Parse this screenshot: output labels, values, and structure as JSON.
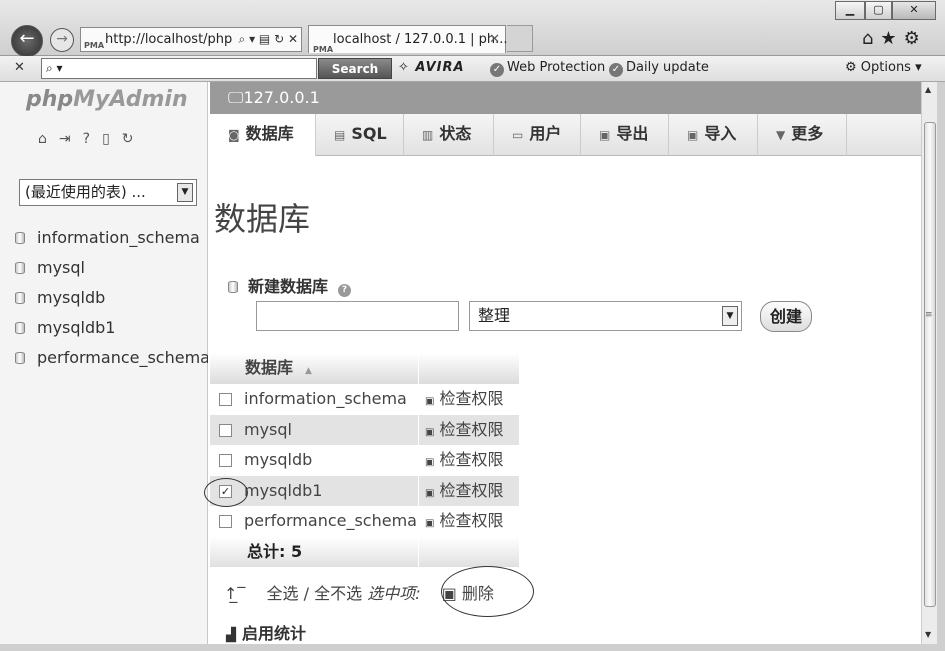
{
  "browser": {
    "address": "http://localhost/php",
    "tab_title": "localhost / 127.0.0.1 | ph...",
    "search_btn": "Search",
    "avira": "AVIRA",
    "web_protection": "Web Protection",
    "daily_update": "Daily update",
    "options": "Options"
  },
  "sidebar": {
    "logo_php": "php",
    "logo_myadmin": "MyAdmin",
    "recent_select": "(最近使用的表) ...",
    "databases": [
      "information_schema",
      "mysql",
      "mysqldb",
      "mysqldb1",
      "performance_schema"
    ]
  },
  "server": "127.0.0.1",
  "tabs": [
    "数据库",
    "SQL",
    "状态",
    "用户",
    "导出",
    "导入",
    "更多"
  ],
  "page_title": "数据库",
  "create": {
    "label": "新建数据库",
    "collation": "整理",
    "button": "创建"
  },
  "table": {
    "header": "数据库",
    "rows": [
      {
        "name": "information_schema",
        "privileges": "检查权限",
        "checked": false
      },
      {
        "name": "mysql",
        "privileges": "检查权限",
        "checked": false
      },
      {
        "name": "mysqldb",
        "privileges": "检查权限",
        "checked": false
      },
      {
        "name": "mysqldb1",
        "privileges": "检查权限",
        "checked": true
      },
      {
        "name": "performance_schema",
        "privileges": "检查权限",
        "checked": false
      }
    ],
    "total": "总计: 5"
  },
  "bulk": {
    "select_all": "全选",
    "divider": "/",
    "select_none": "全不选",
    "with_selected": "选中项:",
    "drop": "删除"
  },
  "stats": "启用统计"
}
